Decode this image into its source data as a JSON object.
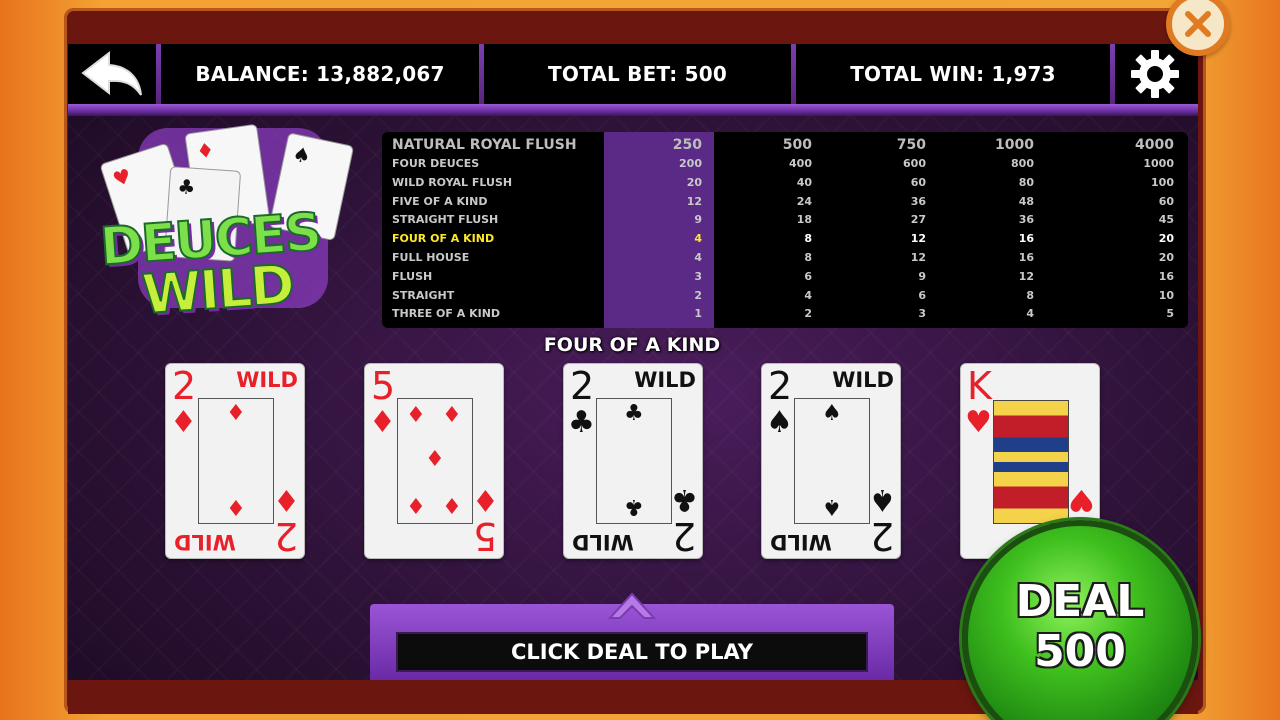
{
  "header": {
    "balance": "BALANCE: 13,882,067",
    "total_bet": "TOTAL BET: 500",
    "total_win": "TOTAL WIN: 1,973"
  },
  "icons": {
    "back": "back-arrow-icon",
    "settings": "gear-icon",
    "close": "close-icon"
  },
  "logo": {
    "line1": "DEUCES",
    "line2": "WILD"
  },
  "paytable": {
    "rows": [
      {
        "name": "NATURAL ROYAL FLUSH",
        "values": [
          "250",
          "500",
          "750",
          "1000",
          "4000"
        ]
      },
      {
        "name": "FOUR DEUCES",
        "values": [
          "200",
          "400",
          "600",
          "800",
          "1000"
        ]
      },
      {
        "name": "WILD ROYAL FLUSH",
        "values": [
          "20",
          "40",
          "60",
          "80",
          "100"
        ]
      },
      {
        "name": "FIVE OF A KIND",
        "values": [
          "12",
          "24",
          "36",
          "48",
          "60"
        ]
      },
      {
        "name": "STRAIGHT FLUSH",
        "values": [
          "9",
          "18",
          "27",
          "36",
          "45"
        ]
      },
      {
        "name": "FOUR OF A KIND",
        "values": [
          "4",
          "8",
          "12",
          "16",
          "20"
        ]
      },
      {
        "name": "FULL HOUSE",
        "values": [
          "4",
          "8",
          "12",
          "16",
          "20"
        ]
      },
      {
        "name": "FLUSH",
        "values": [
          "3",
          "6",
          "9",
          "12",
          "16"
        ]
      },
      {
        "name": "STRAIGHT",
        "values": [
          "2",
          "4",
          "6",
          "8",
          "10"
        ]
      },
      {
        "name": "THREE OF A KIND",
        "values": [
          "1",
          "2",
          "3",
          "4",
          "5"
        ]
      }
    ],
    "highlighted_row": 5,
    "highlighted_column": 0
  },
  "hand_result": "FOUR OF A KIND",
  "cards": [
    {
      "rank": "2",
      "suit": "♦",
      "color": "red",
      "wild": "WILD"
    },
    {
      "rank": "5",
      "suit": "♦",
      "color": "red",
      "wild": ""
    },
    {
      "rank": "2",
      "suit": "♣",
      "color": "black",
      "wild": "WILD"
    },
    {
      "rank": "2",
      "suit": "♠",
      "color": "black",
      "wild": "WILD"
    },
    {
      "rank": "K",
      "suit": "♥",
      "color": "red",
      "wild": ""
    }
  ],
  "message": "CLICK DEAL TO PLAY",
  "deal_button": {
    "label": "DEAL",
    "amount": "500"
  },
  "colors": {
    "accent_purple": "#6a2aa6",
    "highlight_yellow": "#ffe82a",
    "deal_green": "#3fbf1e",
    "card_red": "#e8202a"
  }
}
